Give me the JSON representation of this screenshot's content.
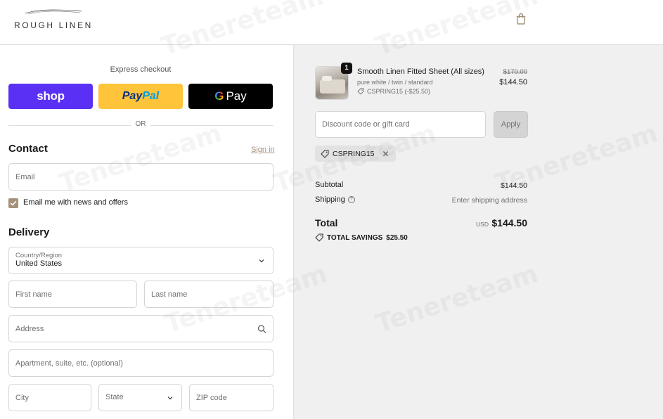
{
  "header": {
    "logo_text": "ROUGH LINEN",
    "cart_icon": "shopping-bag-icon"
  },
  "express": {
    "title": "Express checkout",
    "shop_label": "shop",
    "paypal_a": "Pay",
    "paypal_b": "Pal",
    "gpay_g": "G",
    "gpay_label": "Pay",
    "or_label": "OR"
  },
  "contact": {
    "title": "Contact",
    "signin": "Sign in",
    "email_placeholder": "Email",
    "newsletter_label": "Email me with news and offers",
    "newsletter_checked": true
  },
  "delivery": {
    "title": "Delivery",
    "country_label": "Country/Region",
    "country_value": "United States",
    "first_name_placeholder": "First name",
    "last_name_placeholder": "Last name",
    "address_placeholder": "Address",
    "apartment_placeholder": "Apartment, suite, etc. (optional)",
    "city_placeholder": "City",
    "state_placeholder": "State",
    "zip_placeholder": "ZIP code"
  },
  "order": {
    "product": {
      "name": "Smooth Linen Fitted Sheet (All sizes)",
      "variant": "pure white / twin / standard",
      "discount": "CSPRING15 (-$25.50)",
      "quantity": "1",
      "original_price": "$170.00",
      "price": "$144.50"
    },
    "discount_placeholder": "Discount code or gift card",
    "apply_label": "Apply",
    "applied_code": "CSPRING15",
    "subtotal_label": "Subtotal",
    "subtotal_value": "$144.50",
    "shipping_label": "Shipping",
    "shipping_value": "Enter shipping address",
    "total_label": "Total",
    "total_currency": "USD",
    "total_value": "$144.50",
    "savings_label": "TOTAL SAVINGS",
    "savings_value": "$25.50"
  },
  "watermark": "Tenereteam",
  "colors": {
    "shop_pay": "#5a31f4",
    "paypal": "#ffc439",
    "gpay": "#000000",
    "accent": "#a5907a",
    "summary_bg": "#f0f0f0"
  }
}
